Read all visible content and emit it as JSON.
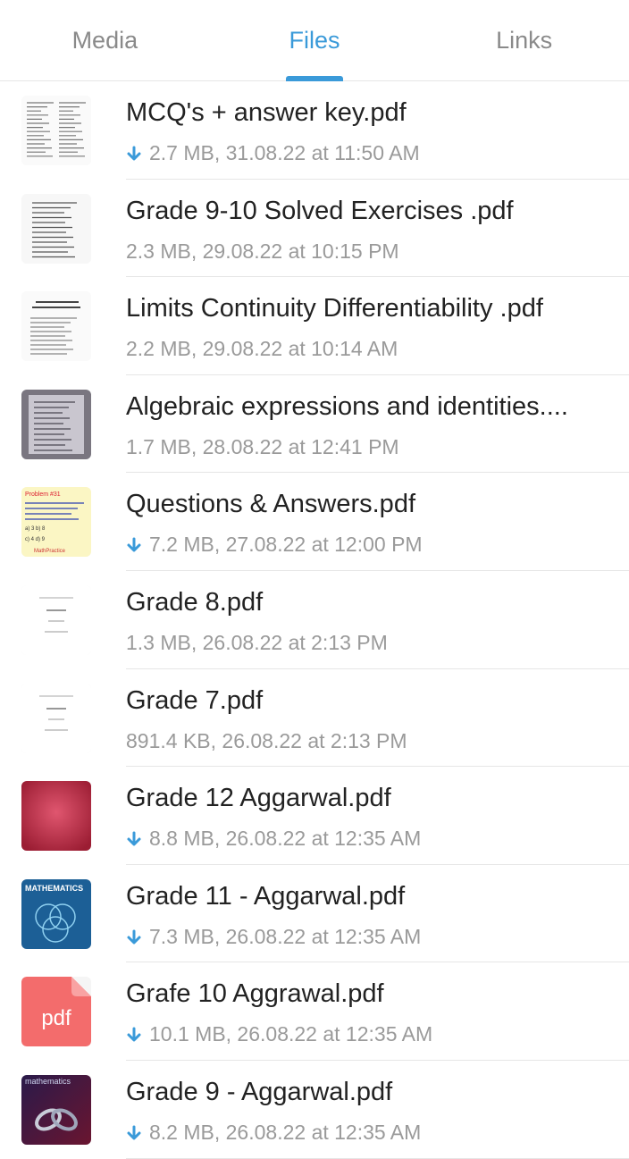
{
  "tabs": [
    {
      "label": "Media",
      "active": false
    },
    {
      "label": "Files",
      "active": true
    },
    {
      "label": "Links",
      "active": false
    }
  ],
  "accent_color": "#3a9ad9",
  "files": [
    {
      "name": "MCQ's + answer key.pdf",
      "meta": "2.7 MB, 31.08.22 at 11:50 AM",
      "downloaded": false,
      "thumb": "doc-table"
    },
    {
      "name": "Grade 9-10 Solved Exercises .pdf",
      "meta": "2.3 MB, 29.08.22 at 10:15 PM",
      "downloaded": true,
      "thumb": "doc-handwritten"
    },
    {
      "name": "Limits Continuity Differentiability .pdf",
      "meta": "2.2 MB, 29.08.22 at 10:14 AM",
      "downloaded": true,
      "thumb": "doc-title"
    },
    {
      "name": "Algebraic expressions and identities....",
      "meta": "1.7 MB, 28.08.22 at 12:41 PM",
      "downloaded": true,
      "thumb": "photo-notebook"
    },
    {
      "name": "Questions & Answers.pdf",
      "meta": "7.2 MB, 27.08.22 at 12:00 PM",
      "downloaded": false,
      "thumb": "yellow-question"
    },
    {
      "name": "Grade 8.pdf",
      "meta": "1.3 MB, 26.08.22 at 2:13 PM",
      "downloaded": true,
      "thumb": "doc-sparse"
    },
    {
      "name": "Grade 7.pdf",
      "meta": "891.4 KB, 26.08.22 at 2:13 PM",
      "downloaded": true,
      "thumb": "doc-sparse"
    },
    {
      "name": "Grade 12 Aggarwal.pdf",
      "meta": "8.8 MB, 26.08.22 at 12:35 AM",
      "downloaded": false,
      "thumb": "red-cover"
    },
    {
      "name": "Grade 11 - Aggarwal.pdf",
      "meta": "7.3 MB, 26.08.22 at 12:35 AM",
      "downloaded": false,
      "thumb": "math-cover"
    },
    {
      "name": "Grafe 10 Aggrawal.pdf",
      "meta": "10.1 MB, 26.08.22 at 12:35 AM",
      "downloaded": false,
      "thumb": "pdf-icon"
    },
    {
      "name": "Grade 9 - Aggarwal.pdf",
      "meta": "8.2 MB, 26.08.22 at 12:35 AM",
      "downloaded": false,
      "thumb": "chain-cover"
    }
  ],
  "thumb_text": {
    "math_cover_title": "MATHEMATICS",
    "pdf_label": "pdf",
    "chain_cover_title": "mathematics",
    "yellow_line1": "Problem #31",
    "yellow_line2": "MathPractice"
  }
}
